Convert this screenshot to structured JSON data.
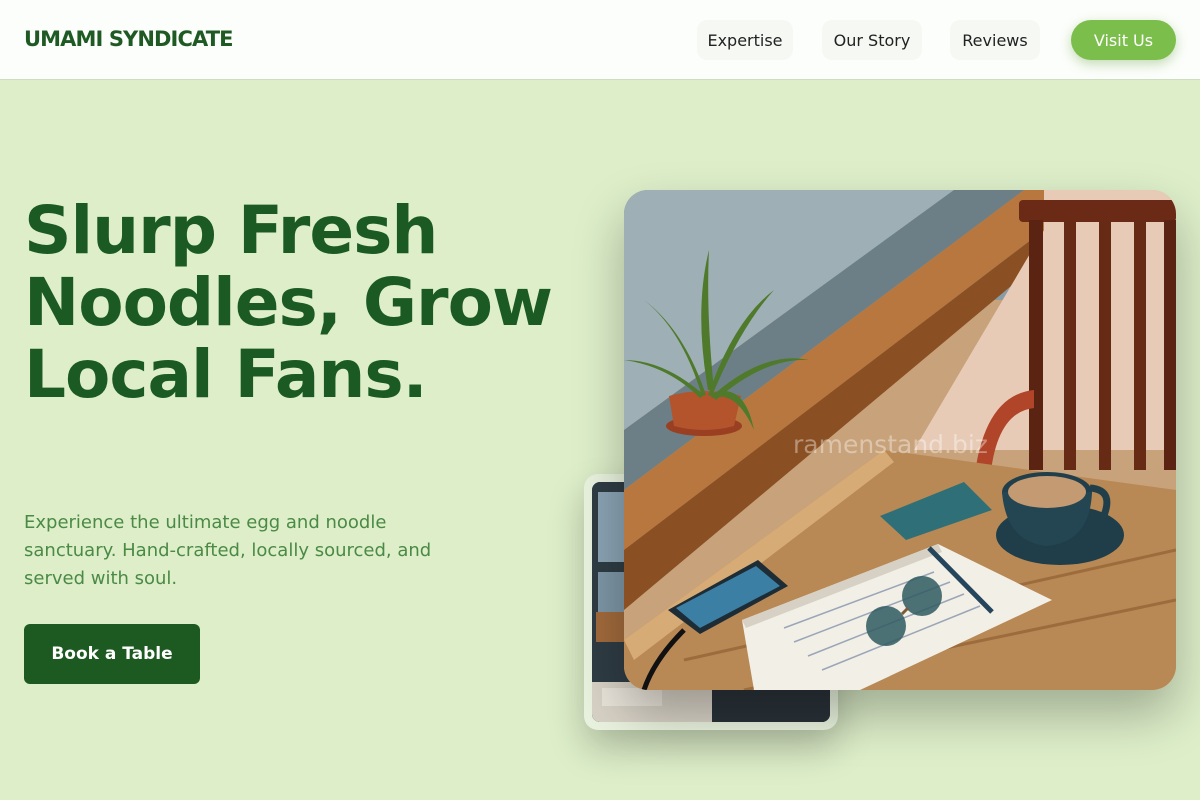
{
  "brand": {
    "name": "UMAMI SYNDICATE"
  },
  "nav": {
    "links": [
      "Expertise",
      "Our Story",
      "Reviews"
    ],
    "cta": "Visit Us"
  },
  "hero": {
    "title": "Slurp Fresh Noodles, Grow Local Fans.",
    "subtitle": "Experience the ultimate egg and noodle sanctuary. Hand-crafted, locally sourced, and served with soul.",
    "button": "Book a Table"
  },
  "images": {
    "main_alt": "Cafe window table with plant, notebook, sunglasses, phone and coffee",
    "secondary_alt": "Cafe interior",
    "watermark": "ramenstand.biz"
  },
  "colors": {
    "brand": "#1c5a24",
    "accent": "#7cbe4c",
    "background": "#ddeec9"
  }
}
